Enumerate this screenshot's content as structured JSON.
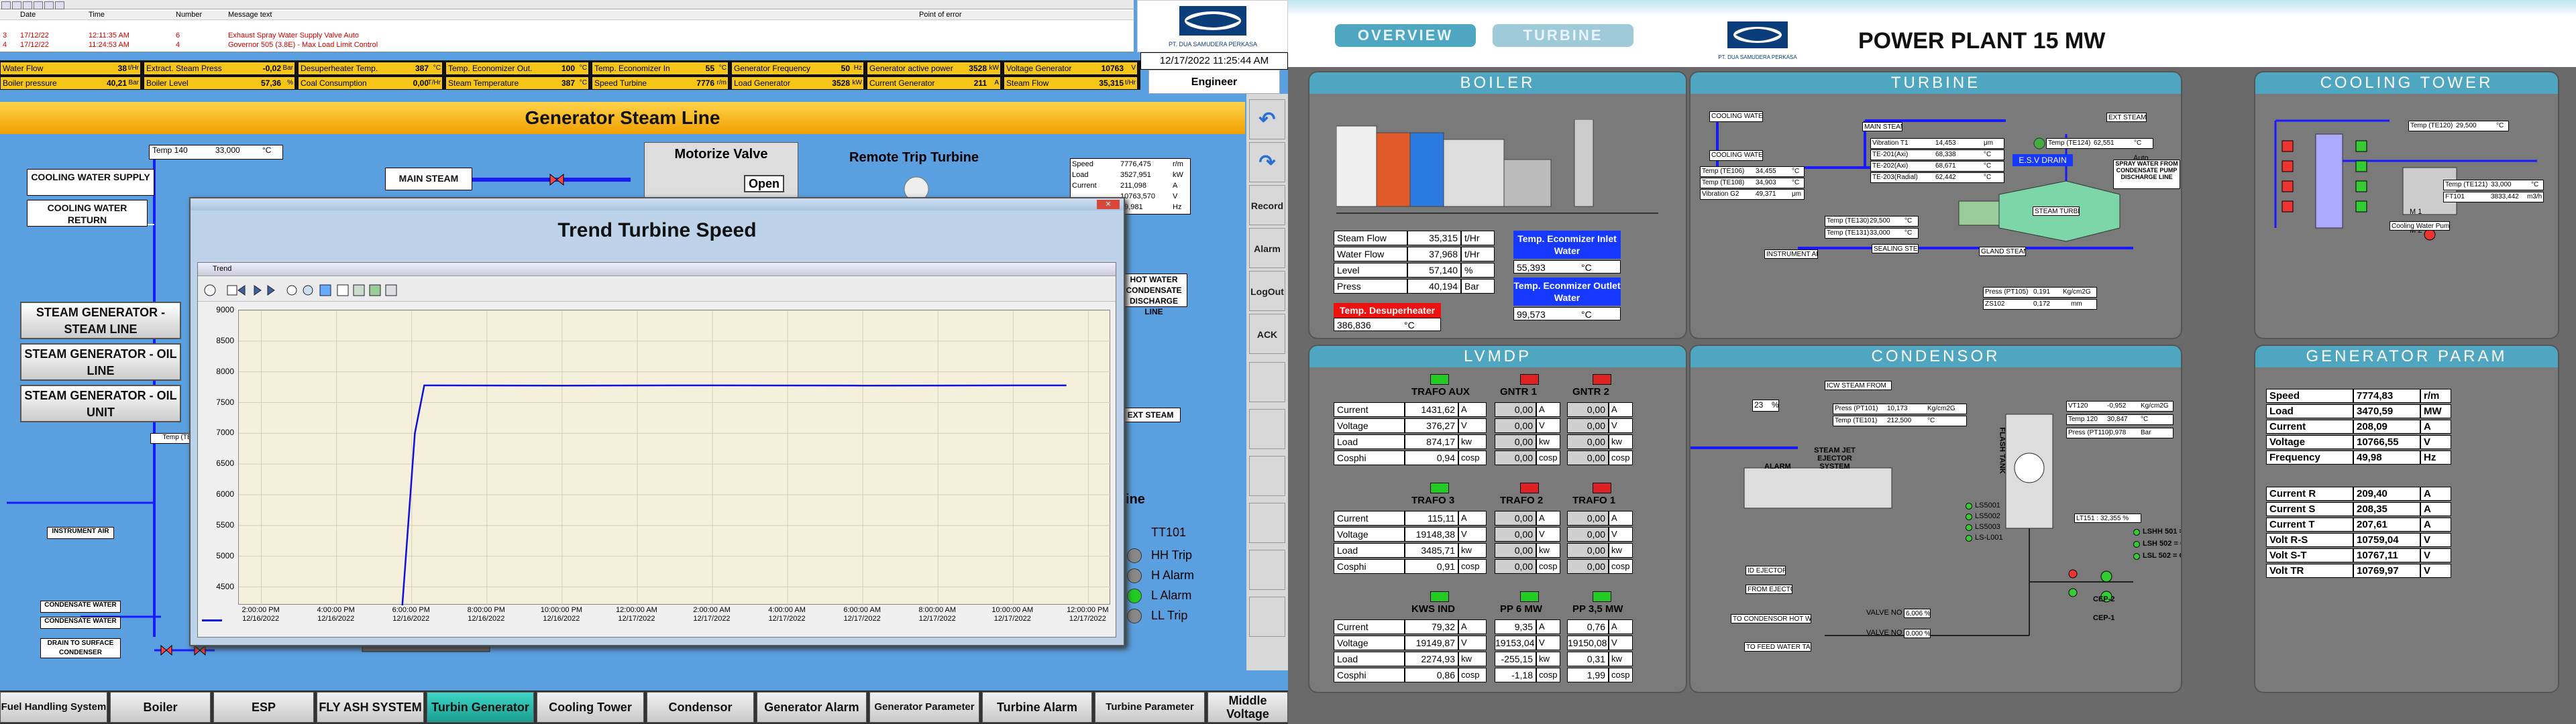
{
  "left": {
    "alarm_table": {
      "headers": [
        "Date",
        "Time",
        "Number",
        "Message text",
        "Point of error"
      ],
      "rows": [
        {
          "idx": "3",
          "date": "17/12/22",
          "time": "12:11:35 AM",
          "number": "6",
          "message": "Exhaust Spray Water Supply Valve Auto"
        },
        {
          "idx": "4",
          "date": "17/12/22",
          "time": "11:24:53 AM",
          "number": "4",
          "message": "Governor 505 (3.8E) - Max Load Limit Control"
        }
      ]
    },
    "tags": [
      {
        "label": "Water Flow",
        "value": "38",
        "unit": "t/Hr"
      },
      {
        "label": "Extract. Steam Press",
        "value": "-0,02",
        "unit": "Bar"
      },
      {
        "label": "Desuperheater Temp.",
        "value": "387",
        "unit": "°C"
      },
      {
        "label": "Temp. Economizer Out.",
        "value": "100",
        "unit": "°C"
      },
      {
        "label": "Temp. Economizer In",
        "value": "55",
        "unit": "°C"
      },
      {
        "label": "Generator Frequency",
        "value": "50",
        "unit": "Hz"
      },
      {
        "label": "Generator active power",
        "value": "3528",
        "unit": "kW"
      },
      {
        "label": "Voltage Generator",
        "value": "10763",
        "unit": "V"
      },
      {
        "label": "Boiler pressure",
        "value": "40,21",
        "unit": "Bar"
      },
      {
        "label": "Boiler Level",
        "value": "57,36",
        "unit": "%"
      },
      {
        "label": "Coal Consumption",
        "value": "0,00",
        "unit": "T/Hr"
      },
      {
        "label": "Steam Temperature",
        "value": "387",
        "unit": "°C"
      },
      {
        "label": "Speed Turbine",
        "value": "7776",
        "unit": "r/m"
      },
      {
        "label": "Load Generator",
        "value": "3528",
        "unit": "kW"
      },
      {
        "label": "Current Generator",
        "value": "211",
        "unit": "A"
      },
      {
        "label": "Steam Flow",
        "value": "35,315",
        "unit": "t/Hr"
      }
    ],
    "datetime": "12/17/2022 11:25:44 AM",
    "user": "Engineer",
    "logo_text": "PT. DUA SAMUDERA PERKASA",
    "screen_title": "Generator Steam Line",
    "side_buttons": [
      "Record",
      "Alarm",
      "LogOut",
      "ACK"
    ],
    "temp140_label": "Temp 140",
    "temp140_value": "33,000",
    "temp140_unit": "°C",
    "cooling_supply": "COOLING WATER SUPPLY",
    "cooling_return": "COOLING WATER RETURN",
    "main_steam": "MAIN STEAM",
    "motorize_valve": "Motorize Valve",
    "open_label": "Open",
    "remote_trip": "Remote Trip Turbine",
    "steam_buttons": [
      "STEAM GENERATOR - STEAM LINE",
      "STEAM GENERATOR - OIL LINE",
      "STEAM GENERATOR - OIL UNIT"
    ],
    "small_labels": {
      "instrument_air": "INSTRUMENT AIR",
      "condensate1": "CONDENSATE WATER",
      "condensate2": "CONDENSATE WATER",
      "drain": "DRAIN TO SURFACE CONDENSER",
      "hot_water": "HOT WATER CONDENSATE DISCHARGE LINE",
      "exh_steam": "EXT STEAM",
      "temp_te120": "Temp (TE120)"
    },
    "readings": [
      {
        "label": "Speed",
        "value": "7776,475",
        "unit": "r/m"
      },
      {
        "label": "Load",
        "value": "3527,951",
        "unit": "kW"
      },
      {
        "label": "Current",
        "value": "211,098",
        "unit": "A"
      },
      {
        "label": "",
        "value": "10763,570",
        "unit": "V"
      },
      {
        "label": "",
        "value": "49,981",
        "unit": "Hz"
      }
    ],
    "turbine_label": "rbine",
    "tt101": "TT101",
    "tt_alarms": [
      {
        "label": "HH Trip",
        "color": "#888888"
      },
      {
        "label": "H Alarm",
        "color": "#888888"
      },
      {
        "label": "L Alarm",
        "color": "#22cc22"
      },
      {
        "label": "LL Trip",
        "color": "#888888"
      }
    ],
    "nav": [
      "Fuel Handling System",
      "Boiler",
      "ESP",
      "FLY ASH SYSTEM",
      "Turbin Generator",
      "Cooling Tower",
      "Condensor",
      "Generator Alarm",
      "Generator Parameter",
      "Turbine Alarm",
      "Turbine Parameter",
      "Middle Voltage"
    ],
    "nav_active": "Turbin Generator",
    "trend": {
      "title": "Trend Turbine Speed",
      "window_title": "Trend"
    }
  },
  "chart_data": {
    "type": "line",
    "title": "",
    "xlabel": "",
    "ylabel": "",
    "ylim": [
      4200,
      9000
    ],
    "yticks": [
      4500,
      5000,
      5500,
      6000,
      6500,
      7000,
      7500,
      8000,
      8500,
      9000
    ],
    "xticks": [
      {
        "time": "2:00:00 PM",
        "date": "12/16/2022"
      },
      {
        "time": "4:00:00 PM",
        "date": "12/16/2022"
      },
      {
        "time": "6:00:00 PM",
        "date": "12/16/2022"
      },
      {
        "time": "8:00:00 PM",
        "date": "12/16/2022"
      },
      {
        "time": "10:00:00 PM",
        "date": "12/16/2022"
      },
      {
        "time": "12:00:00 AM",
        "date": "12/17/2022"
      },
      {
        "time": "2:00:00 AM",
        "date": "12/17/2022"
      },
      {
        "time": "4:00:00 AM",
        "date": "12/17/2022"
      },
      {
        "time": "6:00:00 AM",
        "date": "12/17/2022"
      },
      {
        "time": "8:00:00 AM",
        "date": "12/17/2022"
      },
      {
        "time": "10:00:00 AM",
        "date": "12/17/2022"
      },
      {
        "time": "12:00:00 PM",
        "date": "12/17/2022"
      }
    ],
    "series": [
      {
        "color": "#1010dd",
        "points": [
          {
            "x": "12/16/2022 5:45 PM",
            "y": 4200
          },
          {
            "x": "12/16/2022 6:05 PM",
            "y": 7000
          },
          {
            "x": "12/16/2022 6:20 PM",
            "y": 7780
          },
          {
            "x": "12/16/2022 10:00 PM",
            "y": 7775
          },
          {
            "x": "12/17/2022 2:00 AM",
            "y": 7780
          },
          {
            "x": "12/17/2022 6:00 AM",
            "y": 7776
          },
          {
            "x": "12/17/2022 11:25 AM",
            "y": 7780
          }
        ]
      }
    ]
  },
  "right": {
    "tabs": [
      "OVERVIEW",
      "TURBINE"
    ],
    "title": "POWER PLANT 15 MW",
    "logo_text": "PT. DUA SAMUDERA PERKASA",
    "boiler": {
      "head": "BOILER",
      "rows": [
        {
          "label": "Steam Flow",
          "value": "35,315",
          "unit": "t/Hr"
        },
        {
          "label": "Water Flow",
          "value": "37,968",
          "unit": "t/Hr"
        },
        {
          "label": "Level",
          "value": "57,140",
          "unit": "%"
        },
        {
          "label": "Press",
          "value": "40,194",
          "unit": "Bar"
        }
      ],
      "desup_label": "Temp. Desuperheater",
      "desup_value": "386,836",
      "desup_unit": "°C",
      "econ_in_label": "Temp. Econmizer Inlet Water",
      "econ_in_value": "55,393",
      "econ_in_unit": "°C",
      "econ_out_label": "Temp. Econmizer Outlet Water",
      "econ_out_value": "99,573",
      "econ_out_unit": "°C"
    },
    "turbine": {
      "head": "TURBINE",
      "vib": [
        {
          "label": "Vibration T1",
          "value": "14,453",
          "unit": "μm"
        },
        {
          "label": "TE-201(Axi)",
          "value": "68,338",
          "unit": "°C"
        },
        {
          "label": "TE-202(Axi)",
          "value": "68,671",
          "unit": "°C"
        },
        {
          "label": "TE-203(Radial)",
          "value": "62,442",
          "unit": "°C"
        }
      ],
      "temps": [
        {
          "label": "Temp (TE106)",
          "value": "34,455",
          "unit": "°C"
        },
        {
          "label": "Temp (TE108)",
          "value": "34,903",
          "unit": "°C"
        },
        {
          "label": "Vibration G2",
          "value": "49,371",
          "unit": "μm"
        }
      ],
      "te130": {
        "label": "Temp (TE130)",
        "value": "29,500",
        "unit": "°C"
      },
      "te131": {
        "label": "Temp (TE131)",
        "value": "33,000",
        "unit": "°C"
      },
      "te124": {
        "label": "Temp (TE124)",
        "value": "62,551",
        "unit": "°C"
      },
      "pt105": {
        "label": "Press (PT105)",
        "value": "0,191",
        "unit": "Kg/cm2G"
      },
      "zs": {
        "label": "ZS102",
        "value": "0,172",
        "unit": "mm"
      },
      "esv": "E.S.V DRAIN",
      "auto": "Auto",
      "spray": "SPRAY WATER FROM CONDENSATE PUMP DISCHARGE LINE",
      "small": [
        "COOLING WATER SUPPLY",
        "COOLING WATER RETURN",
        "MAIN STEAM",
        "STEAM TURBINE",
        "INSTRUMENT AIR",
        "SEALING STEAM",
        "GLAND STEAM",
        "EXT STEAM"
      ]
    },
    "cooling": {
      "head": "COOLING TOWER",
      "te120": {
        "label": "Temp (TE120)",
        "value": "29,500",
        "unit": "°C"
      },
      "te121": {
        "label": "Temp (TE121)",
        "value": "33,000",
        "unit": "°C"
      },
      "ft101": {
        "label": "FT101",
        "value": "3833,442",
        "unit": "m3/h"
      },
      "fans": [
        "M 1",
        "M 2"
      ],
      "pump_label": "Cooling Water Pump"
    },
    "lvmdp": {
      "head": "LVMDP",
      "groups": [
        {
          "cols": [
            "TRAFO AUX",
            "GNTR 1",
            "GNTR 2"
          ],
          "colors": [
            "#22cc22",
            "#dd2020",
            "#dd2020"
          ],
          "rows": [
            [
              "Current",
              "1431,62",
              "A",
              "0,00",
              "A",
              "0,00",
              "A"
            ],
            [
              "Voltage",
              "376,27",
              "V",
              "0,00",
              "V",
              "0,00",
              "V"
            ],
            [
              "Load",
              "874,17",
              "kw",
              "0,00",
              "kw",
              "0,00",
              "kw"
            ],
            [
              "Cosphi",
              "0,94",
              "cosp",
              "0,00",
              "cosp",
              "0,00",
              "cosp"
            ]
          ]
        },
        {
          "cols": [
            "TRAFO 3",
            "TRAFO 2",
            "TRAFO 1"
          ],
          "colors": [
            "#22cc22",
            "#dd2020",
            "#dd2020"
          ],
          "rows": [
            [
              "Current",
              "115,11",
              "A",
              "0,00",
              "A",
              "0,00",
              "A"
            ],
            [
              "Voltage",
              "19148,38",
              "V",
              "0,00",
              "V",
              "0,00",
              "V"
            ],
            [
              "Load",
              "3485,71",
              "kw",
              "0,00",
              "kw",
              "0,00",
              "kw"
            ],
            [
              "Cosphi",
              "0,91",
              "cosp",
              "0,00",
              "cosp",
              "0,00",
              "cosp"
            ]
          ]
        },
        {
          "cols": [
            "KWS IND",
            "PP 6 MW",
            "PP 3,5 MW"
          ],
          "colors": [
            "#22cc22",
            "#22cc22",
            "#22cc22"
          ],
          "rows": [
            [
              "Current",
              "79,32",
              "A",
              "9,35",
              "A",
              "0,76",
              "A"
            ],
            [
              "Voltage",
              "19149,87",
              "V",
              "19153,04",
              "V",
              "19150,08",
              "V"
            ],
            [
              "Load",
              "2274,93",
              "kw",
              "-255,15",
              "kw",
              "0,31",
              "kw"
            ],
            [
              "Cosphi",
              "0,86",
              "cosp",
              "-1,18",
              "cosp",
              "1,99",
              "cosp"
            ]
          ]
        }
      ]
    },
    "condensor": {
      "head": "CONDENSOR",
      "pt101": {
        "label": "Press (PT101)",
        "value": "10,173",
        "unit": "Kg/cm2G"
      },
      "te101": {
        "label": "Temp (TE101)",
        "value": "212,500",
        "unit": "°C"
      },
      "vt120": {
        "label": "VT120",
        "value": "-0,952",
        "unit": "Kg/cm2G"
      },
      "temp120": {
        "label": "Temp 120",
        "value": "30,847",
        "unit": "°C"
      },
      "pt110": {
        "label": "Press (PT110)",
        "value": "-0,978",
        "unit": "Bar"
      },
      "level": "23",
      "level_unit": "%",
      "small": [
        "ICW STEAM FROM",
        "STEAM JET EJECTOR SYSTEM",
        "ALARM",
        "FLASH TANK",
        "LT151 : 32,355 %",
        "CEP-2",
        "CEP-1",
        "ID EJECTOR",
        "FROM EJECTOR",
        "TO CONDENSOR HOT WELL",
        "TO FEED WATER TANK",
        "VALVE NO",
        "VALVE NO",
        "6,006 %",
        "0,000 %"
      ],
      "switches": [
        "LS5001",
        "LS5002",
        "LS5003",
        "LS-L001"
      ],
      "lls": [
        "LSHH 501 = ON or LT501 > 98%",
        "LSH 502 = ON or LT501 > 75%",
        "LSL 502 = ON or LT501 < 15%"
      ]
    },
    "generator": {
      "head": "GENERATOR PARAM",
      "rows1": [
        {
          "label": "Speed",
          "value": "7774,83",
          "unit": "r/m"
        },
        {
          "label": "Load",
          "value": "3470,59",
          "unit": "MW"
        },
        {
          "label": "Current",
          "value": "208,09",
          "unit": "A"
        },
        {
          "label": "Voltage",
          "value": "10766,55",
          "unit": "V"
        },
        {
          "label": "Frequency",
          "value": "49,98",
          "unit": "Hz"
        }
      ],
      "rows2": [
        {
          "label": "Current R",
          "value": "209,40",
          "unit": "A"
        },
        {
          "label": "Current S",
          "value": "208,35",
          "unit": "A"
        },
        {
          "label": "Current T",
          "value": "207,61",
          "unit": "A"
        },
        {
          "label": "Volt R-S",
          "value": "10759,04",
          "unit": "V"
        },
        {
          "label": "Volt S-T",
          "value": "10767,11",
          "unit": "V"
        },
        {
          "label": "Volt TR",
          "value": "10769,97",
          "unit": "V"
        }
      ]
    }
  }
}
